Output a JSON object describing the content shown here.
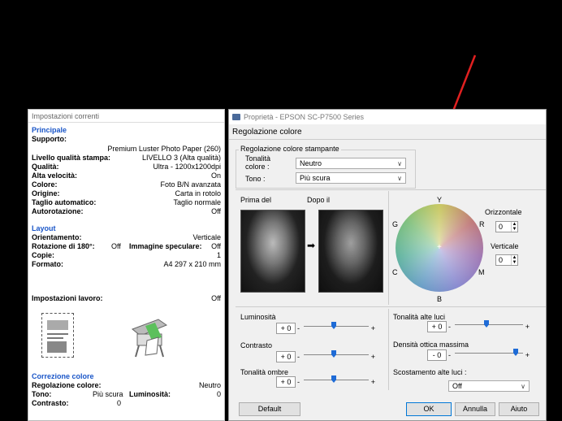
{
  "left": {
    "title": "Impostazioni correnti",
    "principale": "Principale",
    "supporto_label": "Supporto:",
    "supporto_value": "Premium Luster Photo Paper (260)",
    "rows": [
      {
        "k": "Livello qualità stampa:",
        "v": "LIVELLO 3 (Alta qualità)"
      },
      {
        "k": "Qualità:",
        "v": "Ultra - 1200x1200dpi"
      },
      {
        "k": "Alta velocità:",
        "v": "On"
      },
      {
        "k": "Colore:",
        "v": "Foto B/N avanzata"
      },
      {
        "k": "Origine:",
        "v": "Carta in rotolo"
      },
      {
        "k": "Taglio automatico:",
        "v": "Taglio normale"
      },
      {
        "k": "Autorotazione:",
        "v": "Off"
      }
    ],
    "layout": "Layout",
    "orientamento_label": "Orientamento:",
    "orientamento_value": "Verticale",
    "rotazione_label": "Rotazione di 180°:",
    "rotazione_value": "Off",
    "speculare_label": "Immagine speculare:",
    "speculare_value": "Off",
    "copie_label": "Copie:",
    "copie_value": "1",
    "formato_label": "Formato:",
    "formato_value": "A4 297 x 210 mm",
    "lavoro_label": "Impostazioni lavoro:",
    "lavoro_value": "Off",
    "correzione": "Correzione colore",
    "regolazione_label": "Regolazione colore:",
    "regolazione_value": "Neutro",
    "tono_label": "Tono:",
    "tono_value": "Più scura",
    "luminosita_label": "Luminosità:",
    "luminosita_value": "0",
    "contrasto_label": "Contrasto:",
    "contrasto_value": "0"
  },
  "dialog": {
    "title": "Proprietà - EPSON SC-P7500 Series",
    "subtitle": "Regolazione colore",
    "group_title": "Regolazione colore stampante",
    "tonalita_label": "Tonalità colore :",
    "tonalita_value": "Neutro",
    "tono_label": "Tono :",
    "tono_value": "Più scura",
    "prima_label": "Prima del",
    "dopo_label": "Dopo il",
    "wheel": {
      "top": "Y",
      "left": "G",
      "right": "R",
      "bottom_left": "C",
      "bottom_right": "M",
      "bottom": "B"
    },
    "orizzontale_label": "Orizzontale",
    "orizzontale_value": "0",
    "verticale_label": "Verticale",
    "verticale_value": "0",
    "luminosita_label": "Luminosità",
    "luminosita_value": "+ 0",
    "contrasto_label": "Contrasto",
    "contrasto_value": "+ 0",
    "ombre_label": "Tonalità ombre",
    "ombre_value": "+ 0",
    "alteluci_label": "Tonalità alte luci",
    "alteluci_value": "+ 0",
    "densita_label": "Densità ottica massima",
    "densita_value": "- 0",
    "scostamento_label": "Scostamento alte luci :",
    "scostamento_value": "Off",
    "default_btn": "Default",
    "ok_btn": "OK",
    "annulla_btn": "Annulla",
    "aiuto_btn": "Aiuto"
  },
  "colors": {
    "accent": "#1e6bd6",
    "annotation": "#e02020",
    "section": "#1a56c8"
  }
}
